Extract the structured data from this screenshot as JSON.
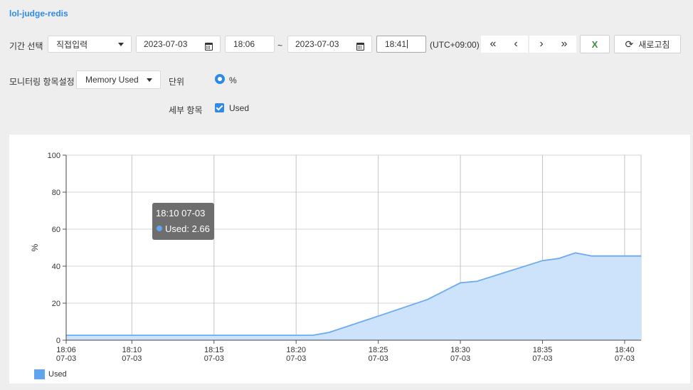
{
  "app_title": "lol-judge-redis",
  "filter": {
    "period_label": "기간 선택",
    "mode_value": "직접입력",
    "start_date": "2023-07-03",
    "start_time": "18:06",
    "tilde": "~",
    "end_date": "2023-07-03",
    "end_time": "18:41",
    "timezone": "(UTC+09:00)",
    "nav": [
      "«",
      "‹",
      "›",
      "»"
    ],
    "excel_label": "X",
    "refresh_label": "새로고침"
  },
  "monitor": {
    "label": "모니터링 항목설정",
    "metric_value": "Memory Used",
    "unit_label": "단위",
    "unit_option": "%",
    "detail_label": "세부 항목",
    "detail_option": "Used"
  },
  "tooltip": {
    "title": "18:10 07-03",
    "text": "Used: 2.66"
  },
  "colors": {
    "accent": "#2e8ae6",
    "series_line": "#6aaaf0",
    "series_fill": "#cde2fb",
    "excel": "#3d8b3d"
  },
  "chart_data": {
    "type": "area",
    "title": "",
    "ylabel": "%",
    "ylim": [
      0,
      100
    ],
    "yticks": [
      0,
      20,
      40,
      60,
      80,
      100
    ],
    "xlim_minutes": [
      "18:06",
      "18:41"
    ],
    "xticks": [
      {
        "t": "18:06",
        "label": "18:06",
        "date": "07-03"
      },
      {
        "t": "18:10",
        "label": "18:10",
        "date": "07-03"
      },
      {
        "t": "18:15",
        "label": "18:15",
        "date": "07-03"
      },
      {
        "t": "18:20",
        "label": "18:20",
        "date": "07-03"
      },
      {
        "t": "18:25",
        "label": "18:25",
        "date": "07-03"
      },
      {
        "t": "18:30",
        "label": "18:30",
        "date": "07-03"
      },
      {
        "t": "18:35",
        "label": "18:35",
        "date": "07-03"
      },
      {
        "t": "18:40",
        "label": "18:40",
        "date": "07-03"
      }
    ],
    "grid": true,
    "legend": "bottom-left",
    "series": [
      {
        "name": "Used",
        "points": [
          [
            "18:06",
            2.66
          ],
          [
            "18:10",
            2.66
          ],
          [
            "18:15",
            2.66
          ],
          [
            "18:20",
            2.66
          ],
          [
            "18:21",
            2.66
          ],
          [
            "18:22",
            4.2
          ],
          [
            "18:25",
            13
          ],
          [
            "18:28",
            22
          ],
          [
            "18:30",
            31
          ],
          [
            "18:31",
            31.8
          ],
          [
            "18:35",
            43
          ],
          [
            "18:36",
            44.2
          ],
          [
            "18:37",
            47.2
          ],
          [
            "18:38",
            45.5
          ],
          [
            "18:41",
            45.5
          ]
        ]
      }
    ]
  }
}
